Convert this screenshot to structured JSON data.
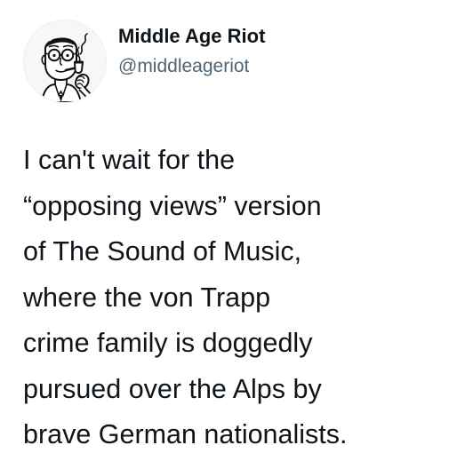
{
  "author": {
    "display_name": "Middle Age Riot",
    "handle": "@middleageriot",
    "avatar_icon": "vintage-pipe-smoking-man-illustration"
  },
  "tweet": {
    "lines": [
      "I can't wait for the",
      "“opposing views” version",
      "of The Sound of Music,",
      "where the von Trapp",
      "crime family is doggedly",
      "pursued over the Alps by",
      "brave German nationalists."
    ]
  },
  "colors": {
    "background": "#ffffff",
    "text_primary": "#0f1419",
    "text_secondary": "#536471"
  }
}
